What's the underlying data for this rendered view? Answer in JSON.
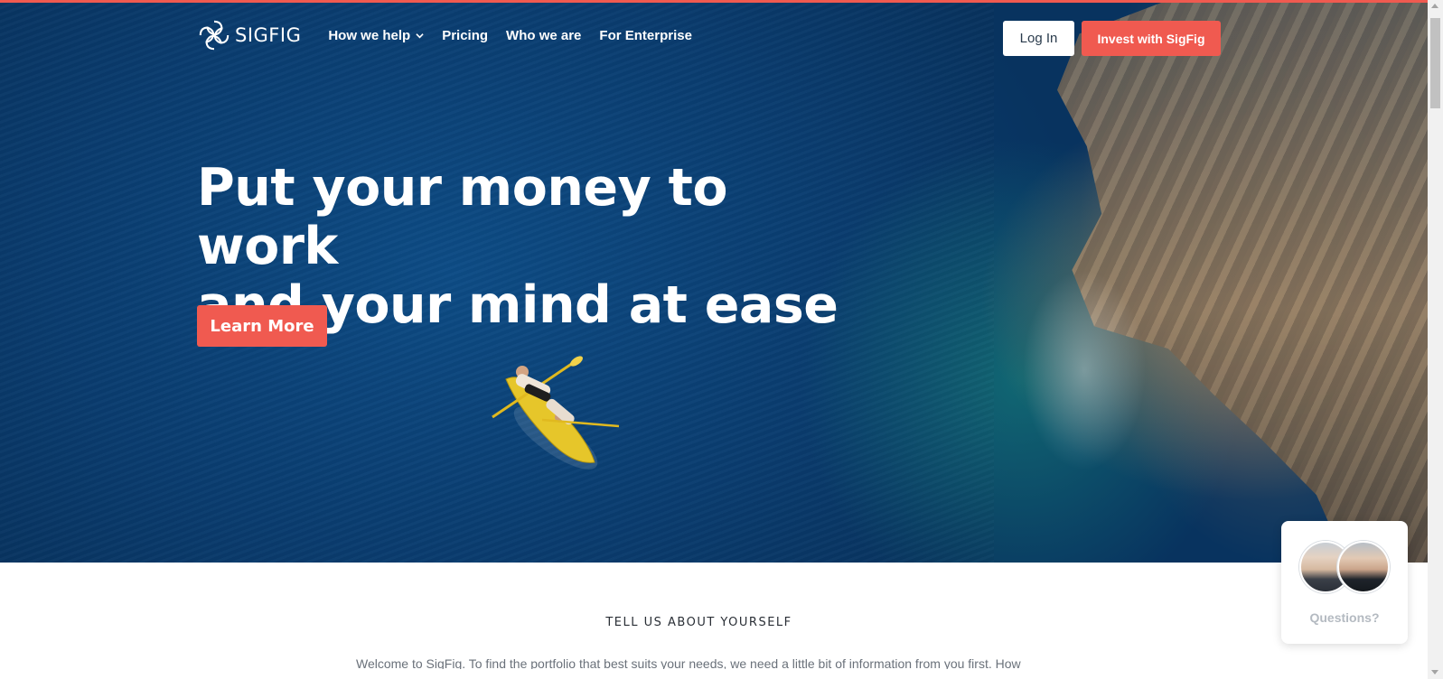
{
  "brand": {
    "name": "SIGFIG",
    "logo_icon": "sigfig-knot-logo"
  },
  "nav": {
    "items": [
      {
        "label": "How we help",
        "has_dropdown": true
      },
      {
        "label": "Pricing"
      },
      {
        "label": "Who we are"
      },
      {
        "label": "For Enterprise"
      }
    ],
    "login_label": "Log In",
    "invest_label": "Invest with SigFig"
  },
  "hero": {
    "headline_line1": "Put your money to work",
    "headline_line2": "and your mind at ease",
    "cta_label": "Learn More"
  },
  "section": {
    "title": "TELL US ABOUT YOURSELF",
    "intro": "Welcome to SigFig. To find the portfolio that best suits your needs, we need a little bit of information from you first. How"
  },
  "chat": {
    "label": "Questions?"
  },
  "colors": {
    "accent": "#f05a50",
    "ocean": "#0a3d70",
    "white": "#ffffff"
  }
}
